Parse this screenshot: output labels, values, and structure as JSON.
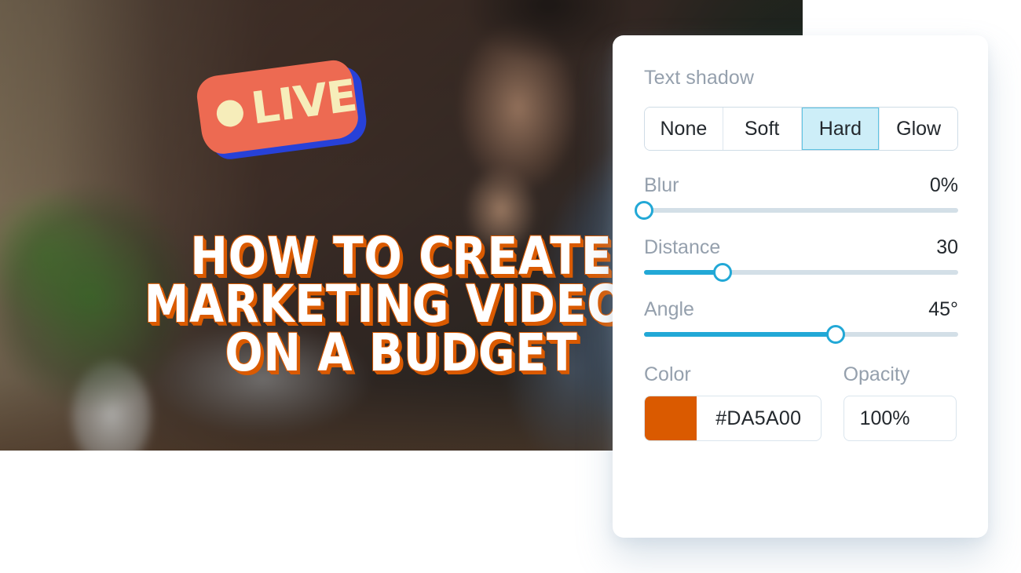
{
  "canvas": {
    "live_badge": {
      "label": "LIVE",
      "dot": "record-dot",
      "fill": "#ED6A52",
      "shadow": "#2741D8",
      "text_color": "#F6EDBA"
    },
    "headline": {
      "lines": [
        "HOW TO CREATE",
        "MARKETING VIDEOS",
        "ON A BUDGET"
      ],
      "text_color": "#FFFFFF",
      "shadow_color": "#DA5A00"
    }
  },
  "panel": {
    "title": "Text shadow",
    "shadow_types": [
      {
        "label": "None",
        "active": false
      },
      {
        "label": "Soft",
        "active": false
      },
      {
        "label": "Hard",
        "active": true
      },
      {
        "label": "Glow",
        "active": false
      }
    ],
    "sliders": [
      {
        "label": "Blur",
        "value": "0%",
        "percent": 0
      },
      {
        "label": "Distance",
        "value": "30",
        "percent": 25
      },
      {
        "label": "Angle",
        "value": "45°",
        "percent": 61
      }
    ],
    "color": {
      "label": "Color",
      "hex": "#DA5A00",
      "swatch": "#DA5A00"
    },
    "opacity": {
      "label": "Opacity",
      "value": "100%"
    },
    "accent": "#22A8D6",
    "active_segment_bg": "#CDEEF8"
  }
}
